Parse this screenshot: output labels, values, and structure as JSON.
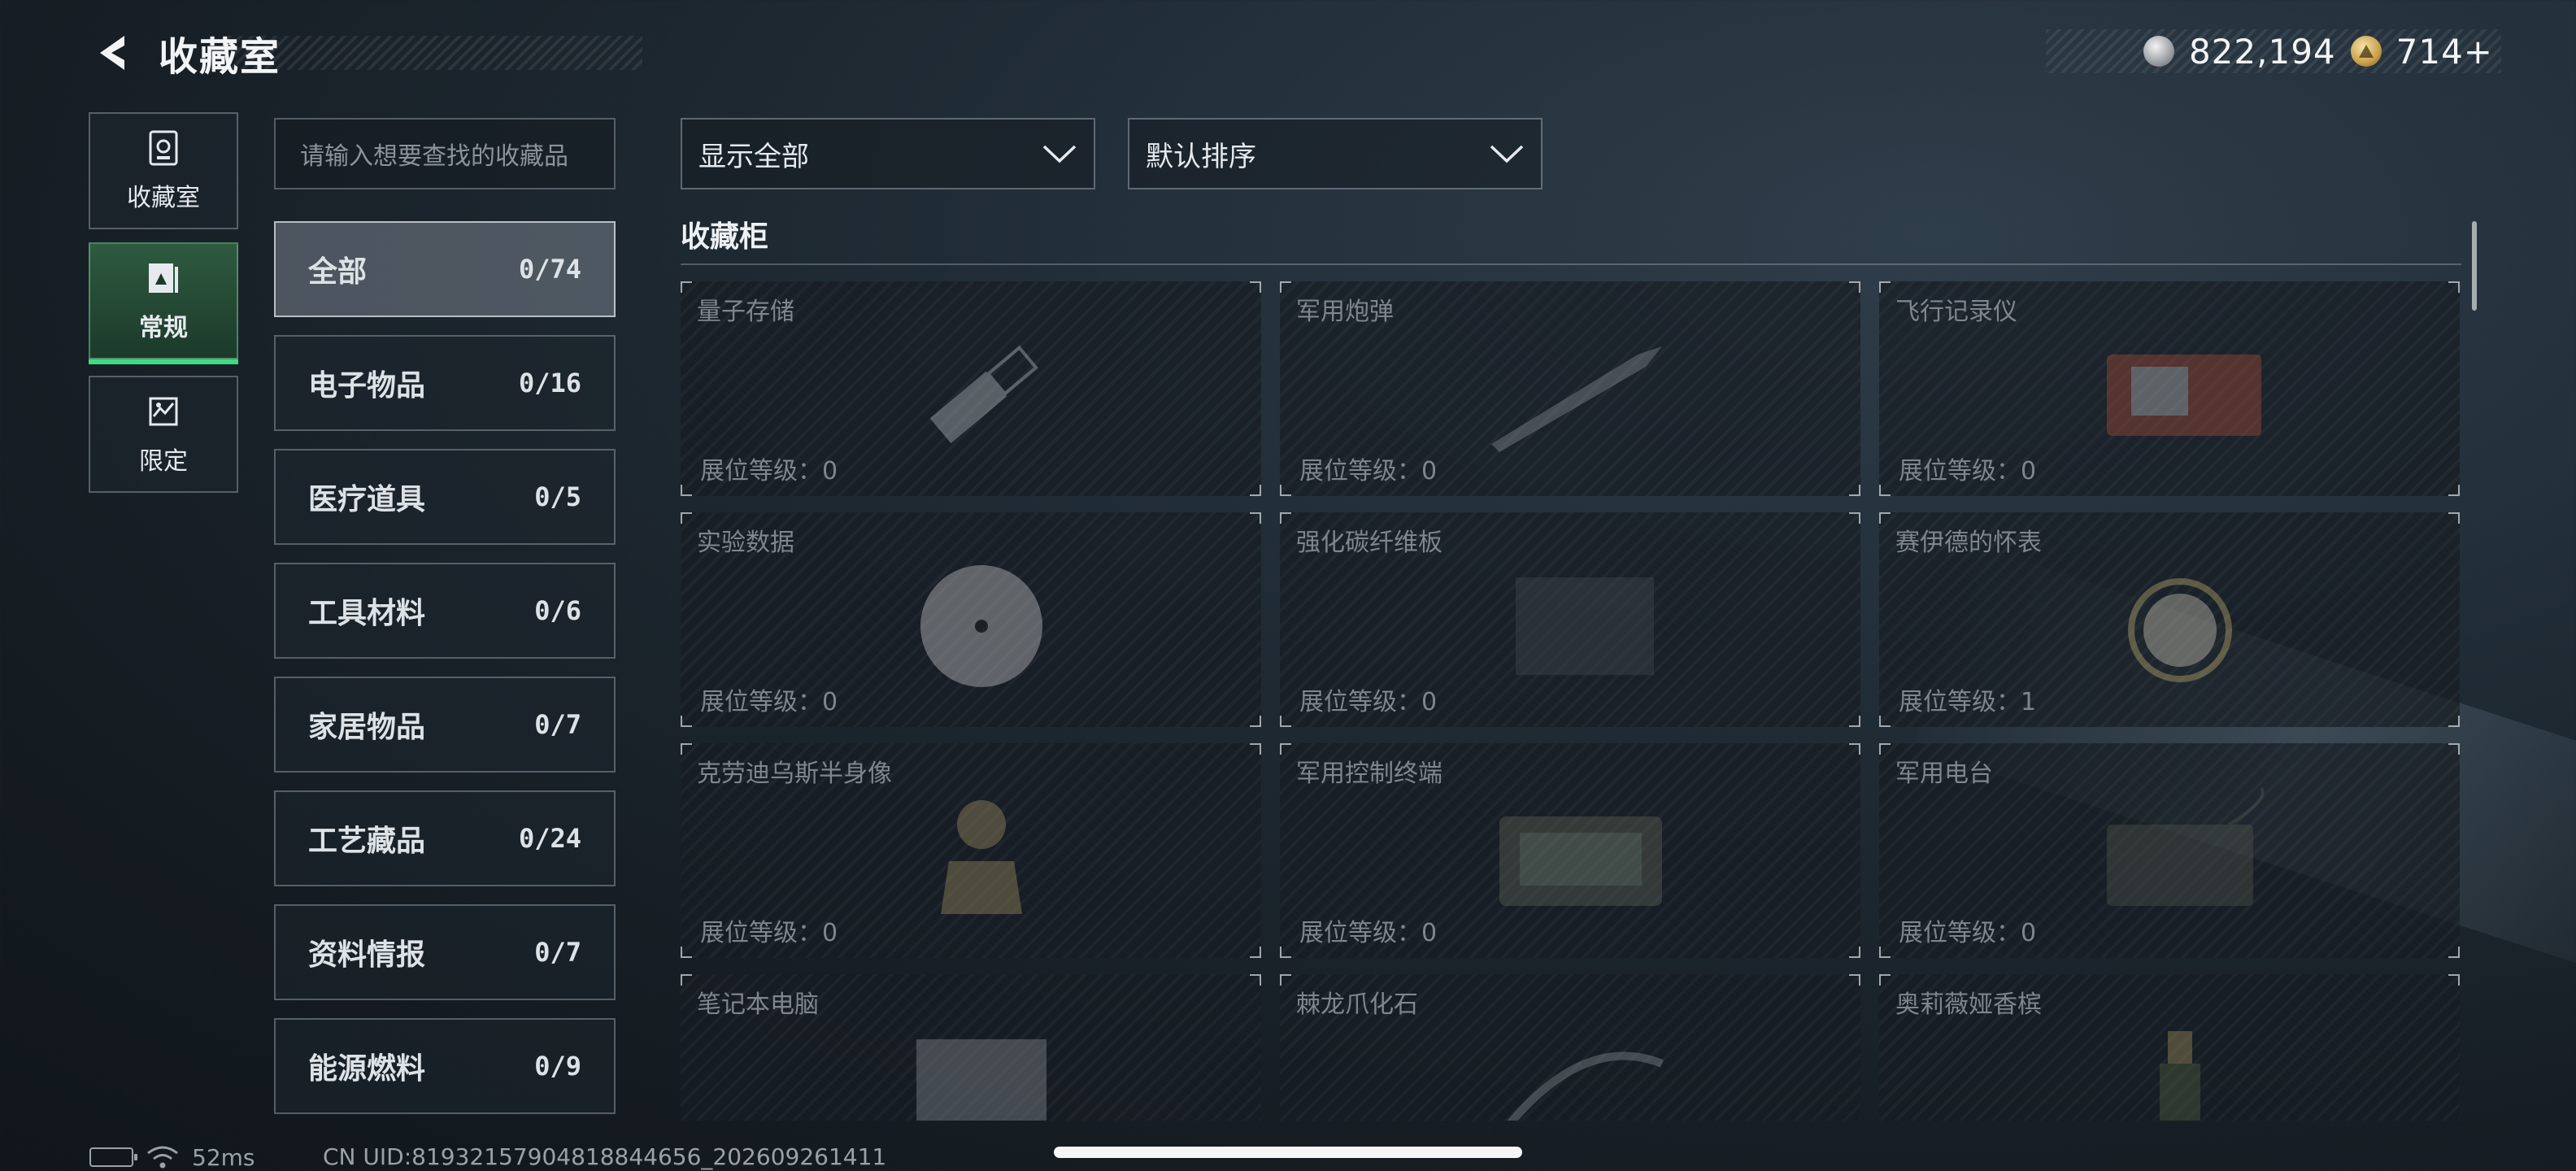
{
  "header": {
    "title": "收藏室",
    "currencies": [
      {
        "icon": "silver-coin-icon",
        "value": "822,194"
      },
      {
        "icon": "gold-coin-icon",
        "value": "714+"
      }
    ]
  },
  "nav": [
    {
      "label": "收藏室",
      "icon": "collection-room-icon",
      "active": false
    },
    {
      "label": "常规",
      "icon": "regular-icon",
      "active": true
    },
    {
      "label": "限定",
      "icon": "limited-icon",
      "active": false
    }
  ],
  "search": {
    "placeholder": "请输入想要查找的收藏品"
  },
  "categories": [
    {
      "name": "全部",
      "count": "0/74",
      "active": true
    },
    {
      "name": "电子物品",
      "count": "0/16"
    },
    {
      "name": "医疗道具",
      "count": "0/5"
    },
    {
      "name": "工具材料",
      "count": "0/6"
    },
    {
      "name": "家居物品",
      "count": "0/7"
    },
    {
      "name": "工艺藏品",
      "count": "0/24"
    },
    {
      "name": "资料情报",
      "count": "0/7"
    },
    {
      "name": "能源燃料",
      "count": "0/9"
    }
  ],
  "filters": {
    "show": "显示全部",
    "sort": "默认排序"
  },
  "section": {
    "title": "收藏柜"
  },
  "items": [
    {
      "name": "量子存储",
      "level": "展位等级：0",
      "icon": "usb-drive-icon"
    },
    {
      "name": "军用炮弹",
      "level": "展位等级：0",
      "icon": "shell-icon"
    },
    {
      "name": "飞行记录仪",
      "level": "展位等级：0",
      "icon": "flight-recorder-icon"
    },
    {
      "name": "实验数据",
      "level": "展位等级：0",
      "icon": "disc-icon"
    },
    {
      "name": "强化碳纤维板",
      "level": "展位等级：0",
      "icon": "carbon-plate-icon"
    },
    {
      "name": "赛伊德的怀表",
      "level": "展位等级：1",
      "icon": "pocket-watch-icon"
    },
    {
      "name": "克劳迪乌斯半身像",
      "level": "展位等级：0",
      "icon": "bust-icon"
    },
    {
      "name": "军用控制终端",
      "level": "展位等级：0",
      "icon": "control-terminal-icon"
    },
    {
      "name": "军用电台",
      "level": "展位等级：0",
      "icon": "radio-icon"
    },
    {
      "name": "笔记本电脑",
      "level": "",
      "icon": "laptop-icon"
    },
    {
      "name": "棘龙爪化石",
      "level": "",
      "icon": "claw-fossil-icon"
    },
    {
      "name": "奥莉薇娅香槟",
      "level": "",
      "icon": "champagne-icon"
    }
  ],
  "status": {
    "ping": "52ms",
    "uid": "CN UID:81932157904818844656_202609261411"
  }
}
